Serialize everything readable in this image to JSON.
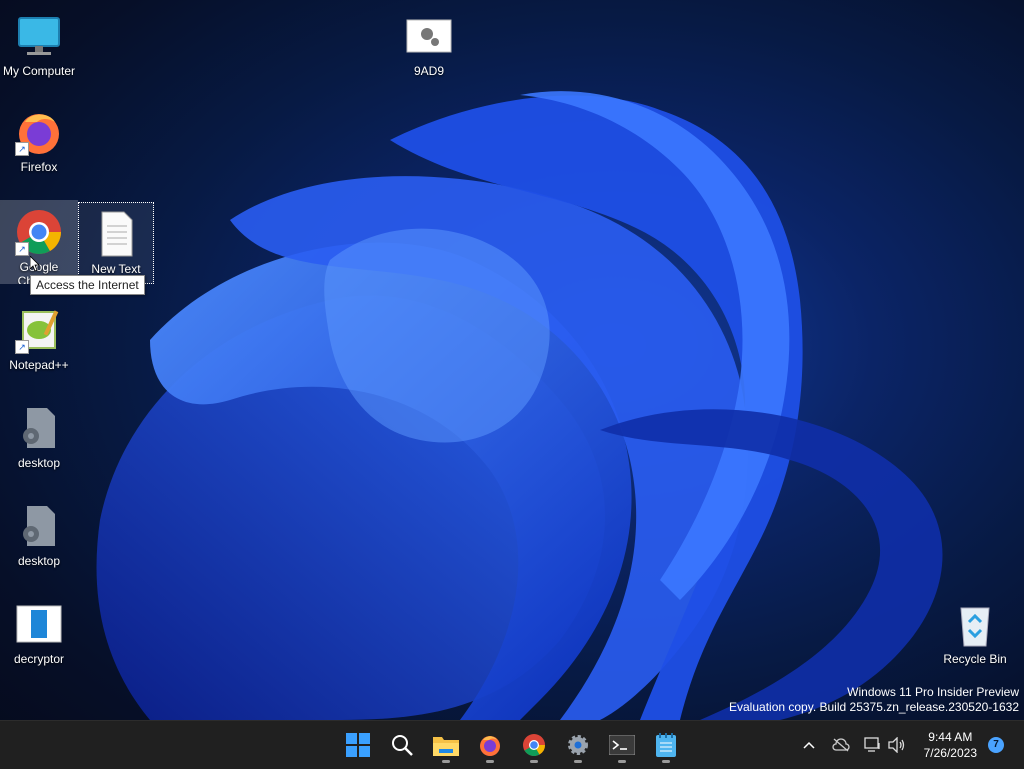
{
  "desktop": {
    "icons": [
      {
        "label": "My Computer"
      },
      {
        "label": "Firefox"
      },
      {
        "label": "Google Chrome",
        "label_visible": "Google Ch"
      },
      {
        "label": "Notepad++"
      },
      {
        "label": "desktop"
      },
      {
        "label": "desktop"
      },
      {
        "label": "decryptor"
      },
      {
        "label": "9AD9"
      },
      {
        "label": "New Text Document",
        "label_visible": "New Text Do..."
      },
      {
        "label": "Recycle Bin"
      }
    ],
    "tooltip": "Access the Internet"
  },
  "watermark": {
    "line1": "Windows 11 Pro Insider Preview",
    "line2": "Evaluation copy. Build 25375.zn_release.230520-1632"
  },
  "taskbar": {
    "apps": [
      {
        "icon": "windows-start-icon"
      },
      {
        "icon": "search-icon"
      },
      {
        "icon": "file-explorer-icon"
      },
      {
        "icon": "firefox-icon"
      },
      {
        "icon": "chrome-icon"
      },
      {
        "icon": "settings-gear-icon"
      },
      {
        "icon": "terminal-icon"
      },
      {
        "icon": "notepad-icon"
      }
    ],
    "tray": {
      "time": "9:44 AM",
      "date": "7/26/2023",
      "notification_count": "7"
    }
  },
  "colors": {
    "accent": "#1a5fd1",
    "taskbar_bg": "#202020",
    "badge": "#4aa3ff"
  }
}
